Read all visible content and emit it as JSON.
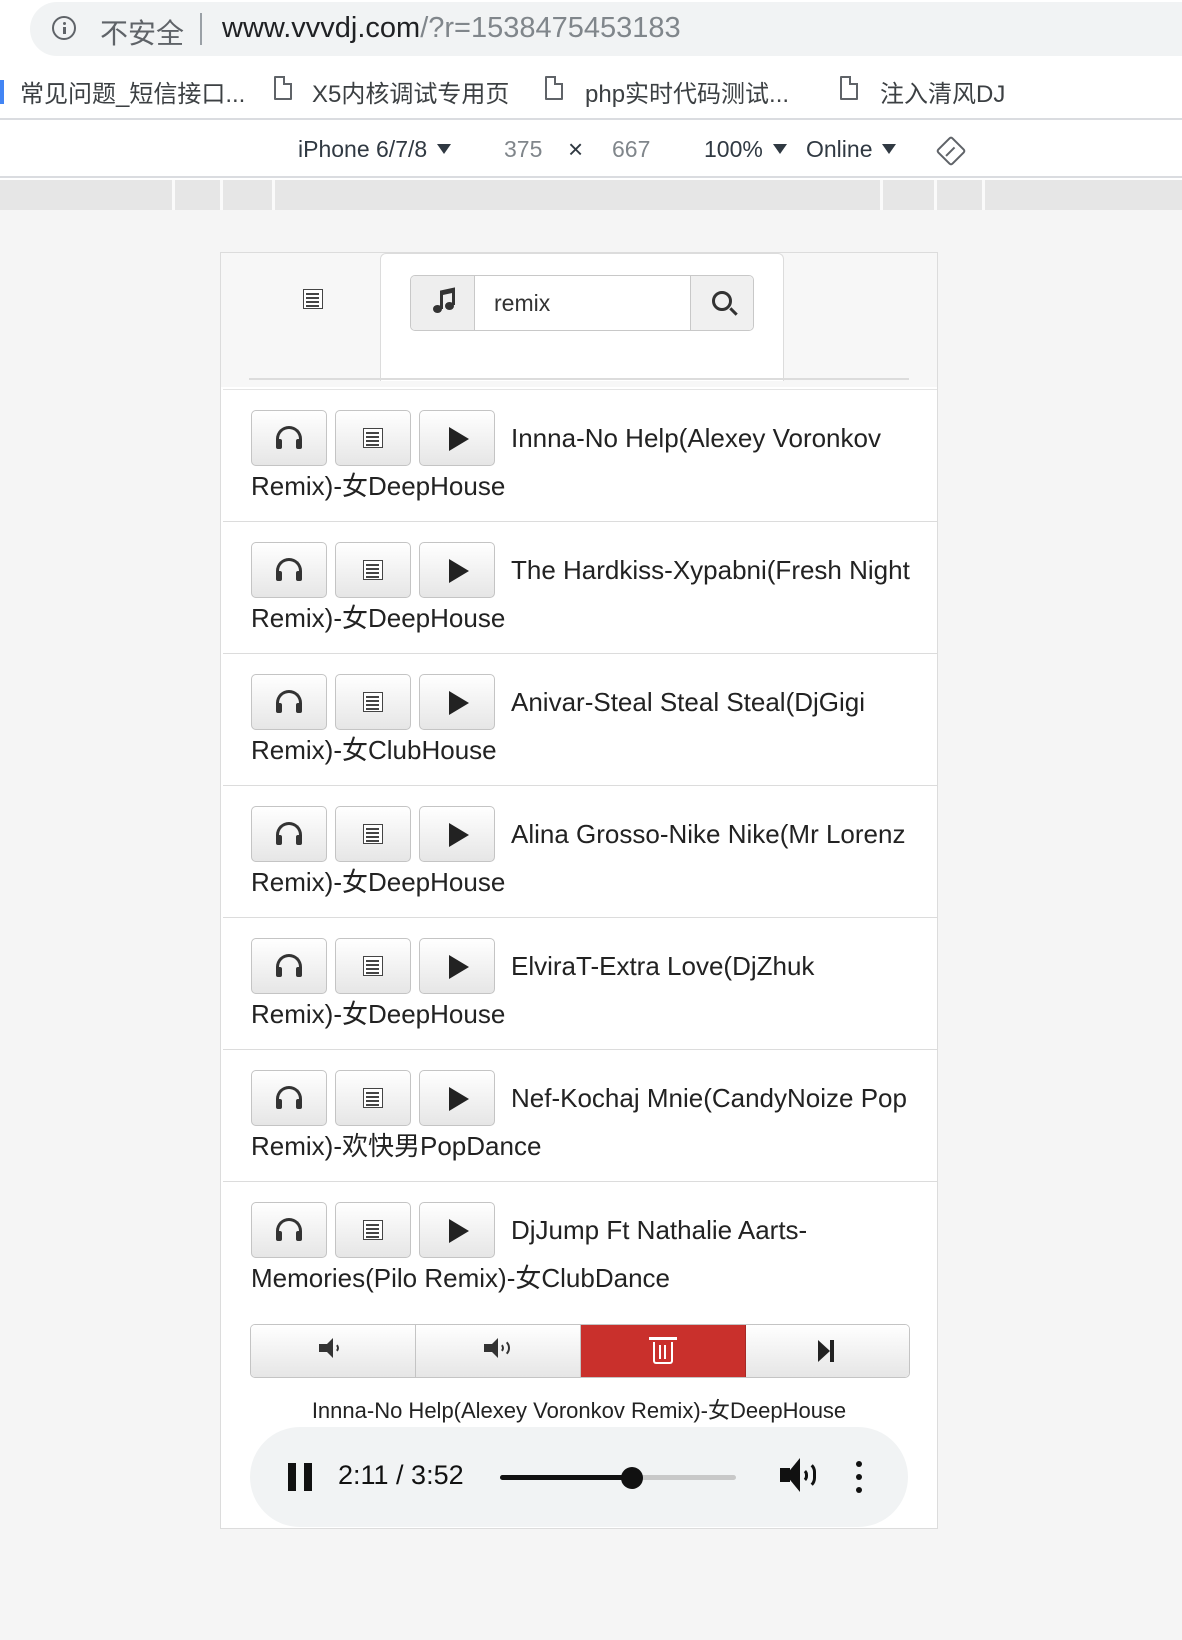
{
  "browser": {
    "security_label": "不安全",
    "url_host": "www.vvvdj.com",
    "url_path": "/?r=1538475453183",
    "bookmarks": [
      "常见问题_短信接口...",
      "X5内核调试专用页",
      "php实时代码测试...",
      "注入清风DJ"
    ]
  },
  "devtools": {
    "device": "iPhone 6/7/8",
    "width": "375",
    "times": "×",
    "height": "667",
    "zoom": "100%",
    "network": "Online"
  },
  "search": {
    "value": "remix"
  },
  "songs": [
    {
      "title": "Innna-No Help(Alexey Voronkov Remix)-女DeepHouse"
    },
    {
      "title": "The Hardkiss-Xypabni(Fresh Night Remix)-女DeepHouse"
    },
    {
      "title": "Anivar-Steal Steal Steal(DjGigi Remix)-女ClubHouse"
    },
    {
      "title": "Alina Grosso-Nike Nike(Mr Lorenz Remix)-女DeepHouse"
    },
    {
      "title": "ElviraT-Extra Love(DjZhuk Remix)-女DeepHouse"
    },
    {
      "title": "Nef-Kochaj Mnie(CandyNoize Pop Remix)-欢快男PopDance"
    },
    {
      "title": "DjJump Ft Nathalie Aarts-Memories(Pilo Remix)-女ClubDance"
    }
  ],
  "player": {
    "now_playing": "Innna-No Help(Alexey Voronkov Remix)-女DeepHouse",
    "time": "2:11 / 3:52",
    "progress": 0.56,
    "delete_color": "#c9302c"
  }
}
